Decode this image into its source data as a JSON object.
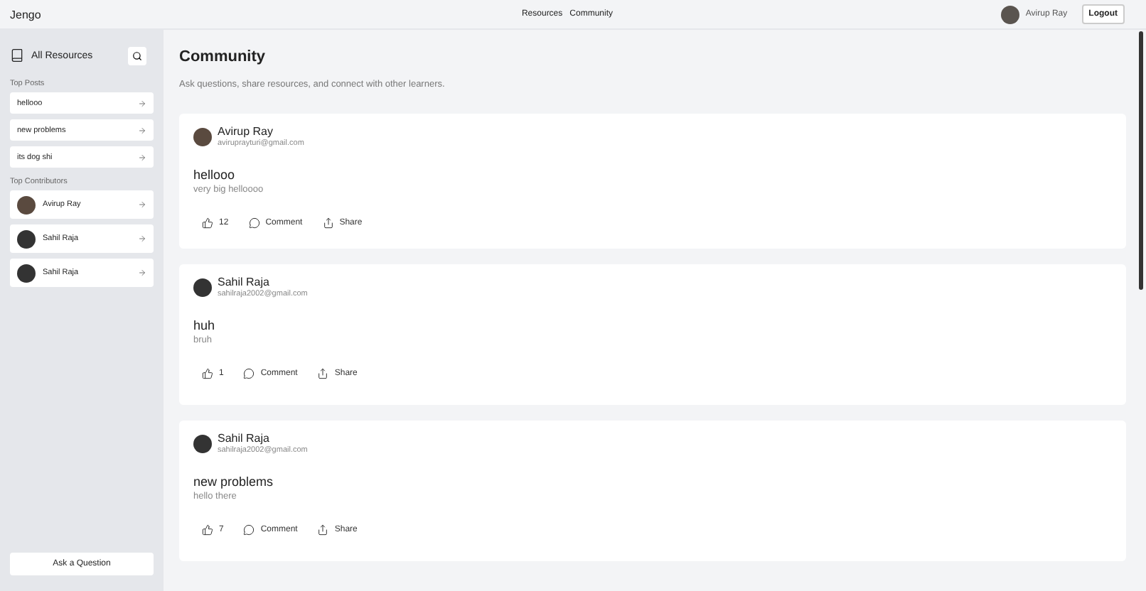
{
  "header": {
    "logo": "Jengo",
    "nav": [
      {
        "label": "Resources"
      },
      {
        "label": "Community"
      }
    ],
    "user": {
      "name": "Avirup Ray"
    },
    "logout": "Logout"
  },
  "sidebar": {
    "title": "All Resources",
    "top_posts_heading": "Top Posts",
    "top_posts": [
      {
        "title": "hellooo"
      },
      {
        "title": "new problems"
      },
      {
        "title": "its dog shi"
      }
    ],
    "top_contributors_heading": "Top Contributors",
    "top_contributors": [
      {
        "name": "Avirup Ray"
      },
      {
        "name": "Sahil Raja"
      },
      {
        "name": "Sahil Raja"
      }
    ],
    "ask_button": "Ask a Question"
  },
  "main": {
    "title": "Community",
    "subtitle": "Ask questions, share resources, and connect with other learners.",
    "posts": [
      {
        "author": "Avirup Ray",
        "email": "aviruprayturi@gmail.com",
        "title": "hellooo",
        "body": "very big helloooo",
        "likes": "12",
        "comment": "Comment",
        "share": "Share"
      },
      {
        "author": "Sahil Raja",
        "email": "sahilraja2002@gmail.com",
        "title": "huh",
        "body": "bruh",
        "likes": "1",
        "comment": "Comment",
        "share": "Share"
      },
      {
        "author": "Sahil Raja",
        "email": "sahilraja2002@gmail.com",
        "title": "new problems",
        "body": "hello there",
        "likes": "7",
        "comment": "Comment",
        "share": "Share"
      }
    ]
  }
}
